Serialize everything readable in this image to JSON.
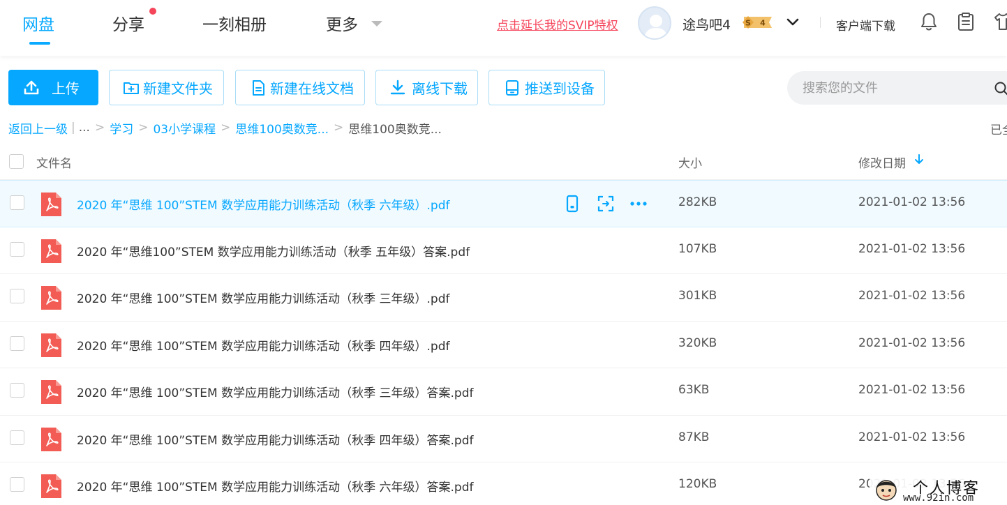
{
  "nav": {
    "tabs": [
      {
        "label": "网盘",
        "active": true
      },
      {
        "label": "分享",
        "has_dot": true
      },
      {
        "label": "一刻相册"
      },
      {
        "label": "更多"
      }
    ],
    "svip_link": "点击延长我的SVIP特权",
    "username": "途鸟吧4",
    "vip_level": "4",
    "client_download": "客户端下载",
    "icons": [
      "bell-icon",
      "clipboard-icon",
      "shirt-icon"
    ]
  },
  "toolbar": {
    "upload": "上传",
    "new_folder": "新建文件夹",
    "new_doc": "新建在线文档",
    "offline_download": "离线下载",
    "push_device": "推送到设备"
  },
  "search": {
    "placeholder": "搜索您的文件"
  },
  "breadcrumb": {
    "back": "返回上一级",
    "ellipsis": "...",
    "items": [
      "学习",
      "03小学课程",
      "思维100奥数竞..."
    ],
    "current": "思维100奥数竞...",
    "loaded_all": "已全"
  },
  "table": {
    "headers": {
      "name": "文件名",
      "size": "大小",
      "date": "修改日期"
    },
    "rows": [
      {
        "name": "2020 年“思维 100”STEM 数学应用能力训练活动（秋季 六年级）.pdf",
        "size": "282KB",
        "date": "2021-01-02 13:56"
      },
      {
        "name": "2020 年“思维100”STEM 数学应用能力训练活动（秋季 五年级）答案.pdf",
        "size": "107KB",
        "date": "2021-01-02 13:56"
      },
      {
        "name": "2020 年“思维 100”STEM 数学应用能力训练活动（秋季 三年级）.pdf",
        "size": "301KB",
        "date": "2021-01-02 13:56"
      },
      {
        "name": "2020 年“思维 100”STEM 数学应用能力训练活动（秋季 四年级）.pdf",
        "size": "320KB",
        "date": "2021-01-02 13:56"
      },
      {
        "name": "2020 年“思维 100”STEM 数学应用能力训练活动（秋季 三年级）答案.pdf",
        "size": "63KB",
        "date": "2021-01-02 13:56"
      },
      {
        "name": "2020 年“思维 100”STEM 数学应用能力训练活动（秋季 四年级）答案.pdf",
        "size": "87KB",
        "date": "2021-01-02 13:56"
      },
      {
        "name": "2020 年“思维 100”STEM 数学应用能力训练活动（秋季 六年级）答案.pdf",
        "size": "120KB",
        "date": "2021-01-02 13:56"
      }
    ]
  },
  "watermark": {
    "title": "个人博客",
    "url": "www.92in.com"
  }
}
